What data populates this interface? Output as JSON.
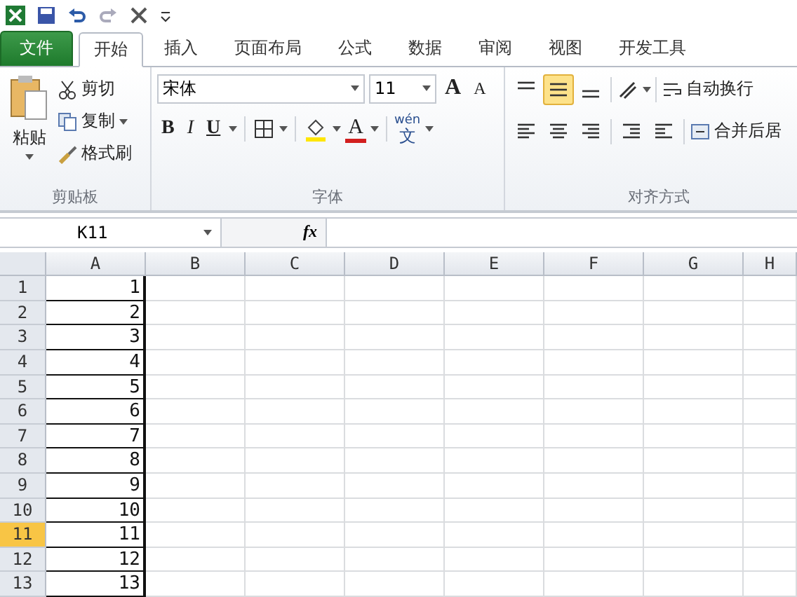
{
  "tabs": [
    {
      "label": "文件",
      "kind": "file",
      "selected": false
    },
    {
      "label": "开始",
      "kind": "tab",
      "selected": true
    },
    {
      "label": "插入",
      "kind": "tab",
      "selected": false
    },
    {
      "label": "页面布局",
      "kind": "tab",
      "selected": false
    },
    {
      "label": "公式",
      "kind": "tab",
      "selected": false
    },
    {
      "label": "数据",
      "kind": "tab",
      "selected": false
    },
    {
      "label": "审阅",
      "kind": "tab",
      "selected": false
    },
    {
      "label": "视图",
      "kind": "tab",
      "selected": false
    },
    {
      "label": "开发工具",
      "kind": "tab",
      "selected": false
    }
  ],
  "clipboard": {
    "label": "剪贴板",
    "paste": "粘贴",
    "cut": "剪切",
    "copy": "复制",
    "format_painter": "格式刷"
  },
  "font": {
    "label": "字体",
    "font_name": "宋体",
    "font_size": "11",
    "grow": "A",
    "shrink": "A",
    "bold": "B",
    "italic": "I",
    "underline": "U",
    "font_color": "A",
    "phonetic_top": "wén",
    "phonetic_char": "文"
  },
  "alignment": {
    "label": "对齐方式",
    "vertical": [
      {
        "kind": "top",
        "selected": false
      },
      {
        "kind": "middle",
        "selected": true
      },
      {
        "kind": "bottom",
        "selected": false
      }
    ],
    "wrap": "自动换行",
    "merge": "合并后居"
  },
  "formula_bar": {
    "name_box": "K11",
    "function_label": "fx"
  },
  "grid": {
    "columns": [
      "A",
      "B",
      "C",
      "D",
      "E",
      "F",
      "G",
      "H"
    ],
    "rows": [
      {
        "header": "1",
        "selected": false,
        "cells": [
          "1"
        ]
      },
      {
        "header": "2",
        "selected": false,
        "cells": [
          "2"
        ]
      },
      {
        "header": "3",
        "selected": false,
        "cells": [
          "3"
        ]
      },
      {
        "header": "4",
        "selected": false,
        "cells": [
          "4"
        ]
      },
      {
        "header": "5",
        "selected": false,
        "cells": [
          "5"
        ]
      },
      {
        "header": "6",
        "selected": false,
        "cells": [
          "6"
        ]
      },
      {
        "header": "7",
        "selected": false,
        "cells": [
          "7"
        ]
      },
      {
        "header": "8",
        "selected": false,
        "cells": [
          "8"
        ]
      },
      {
        "header": "9",
        "selected": false,
        "cells": [
          "9"
        ]
      },
      {
        "header": "10",
        "selected": false,
        "cells": [
          "10"
        ]
      },
      {
        "header": "11",
        "selected": true,
        "cells": [
          "11"
        ]
      },
      {
        "header": "12",
        "selected": false,
        "cells": [
          "12"
        ]
      },
      {
        "header": "13",
        "selected": false,
        "cells": [
          "13"
        ]
      }
    ]
  }
}
